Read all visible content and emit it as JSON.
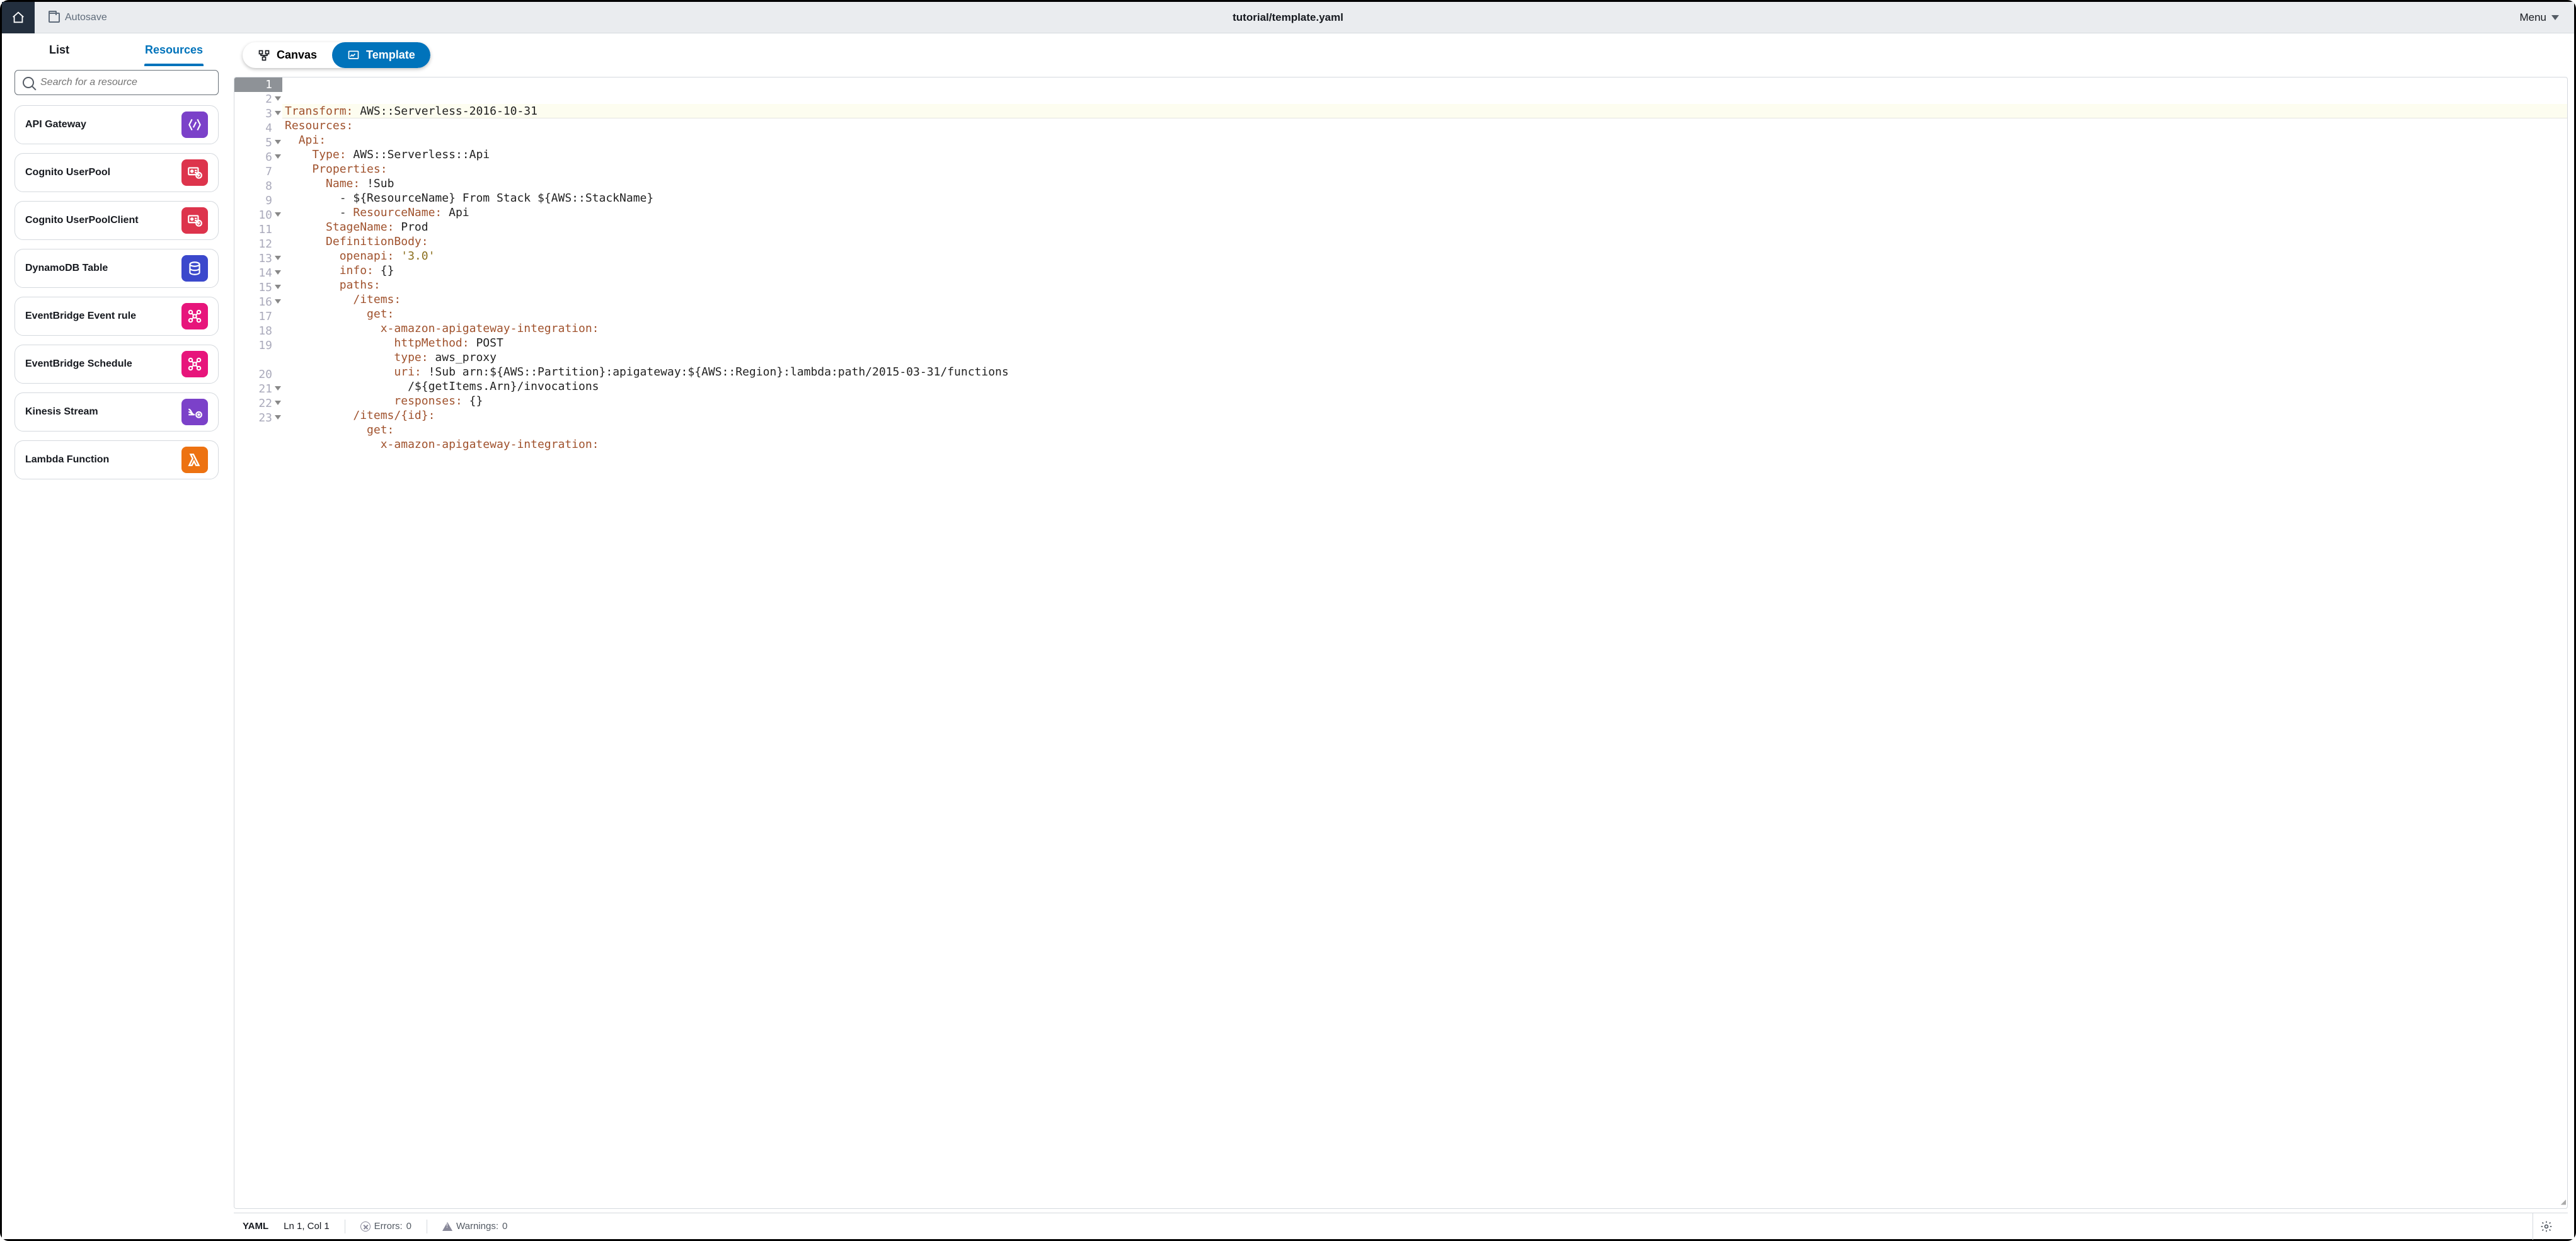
{
  "header": {
    "autosave_label": "Autosave",
    "title": "tutorial/template.yaml",
    "menu_label": "Menu"
  },
  "sidebar": {
    "tabs": {
      "list": "List",
      "resources": "Resources"
    },
    "search_placeholder": "Search for a resource",
    "items": [
      {
        "name": "API Gateway",
        "color": "#7b41c9"
      },
      {
        "name": "Cognito UserPool",
        "color": "#dd344c"
      },
      {
        "name": "Cognito UserPoolClient",
        "color": "#dd344c"
      },
      {
        "name": "DynamoDB Table",
        "color": "#3b48cc"
      },
      {
        "name": "EventBridge Event rule",
        "color": "#e7157b"
      },
      {
        "name": "EventBridge Schedule",
        "color": "#e7157b"
      },
      {
        "name": "Kinesis Stream",
        "color": "#7b41c9"
      },
      {
        "name": "Lambda Function",
        "color": "#ed7211"
      }
    ]
  },
  "view_switch": {
    "canvas": "Canvas",
    "template": "Template"
  },
  "editor": {
    "lines": [
      {
        "n": 1,
        "fold": false,
        "html": "<span class='k'>Transform:</span> <span class='v'>AWS::Serverless-2016-10-31</span>"
      },
      {
        "n": 2,
        "fold": true,
        "html": "<span class='k'>Resources:</span>"
      },
      {
        "n": 3,
        "fold": true,
        "html": "  <span class='k'>Api:</span>"
      },
      {
        "n": 4,
        "fold": false,
        "html": "    <span class='k'>Type:</span> <span class='v'>AWS::Serverless::Api</span>"
      },
      {
        "n": 5,
        "fold": true,
        "html": "    <span class='k'>Properties:</span>"
      },
      {
        "n": 6,
        "fold": true,
        "html": "      <span class='k'>Name:</span> <span class='v'>!Sub</span>"
      },
      {
        "n": 7,
        "fold": false,
        "html": "        - <span class='v'>${ResourceName} From Stack ${AWS::StackName}</span>"
      },
      {
        "n": 8,
        "fold": false,
        "html": "        - <span class='k'>ResourceName:</span> <span class='v'>Api</span>"
      },
      {
        "n": 9,
        "fold": false,
        "html": "      <span class='k'>StageName:</span> <span class='v'>Prod</span>"
      },
      {
        "n": 10,
        "fold": true,
        "html": "      <span class='k'>DefinitionBody:</span>"
      },
      {
        "n": 11,
        "fold": false,
        "html": "        <span class='k'>openapi:</span> <span class='s'>'3.0'</span>"
      },
      {
        "n": 12,
        "fold": false,
        "html": "        <span class='k'>info:</span> <span class='v'>{}</span>"
      },
      {
        "n": 13,
        "fold": true,
        "html": "        <span class='k'>paths:</span>"
      },
      {
        "n": 14,
        "fold": true,
        "html": "          <span class='k'>/items:</span>"
      },
      {
        "n": 15,
        "fold": true,
        "html": "            <span class='k'>get:</span>"
      },
      {
        "n": 16,
        "fold": true,
        "html": "              <span class='k'>x-amazon-apigateway-integration:</span>"
      },
      {
        "n": 17,
        "fold": false,
        "html": "                <span class='k'>httpMethod:</span> <span class='v'>POST</span>"
      },
      {
        "n": 18,
        "fold": false,
        "html": "                <span class='k'>type:</span> <span class='v'>aws_proxy</span>"
      },
      {
        "n": 19,
        "fold": false,
        "html": "                <span class='k'>uri:</span> <span class='v'>!Sub arn:${AWS::Partition}:apigateway:${AWS::Region}:lambda:path/2015-03-31/functions</span>"
      },
      {
        "n": 0,
        "fold": false,
        "html": "                  <span class='v'>/${getItems.Arn}/invocations</span>",
        "nolabel": true
      },
      {
        "n": 20,
        "fold": false,
        "html": "                <span class='k'>responses:</span> <span class='v'>{}</span>"
      },
      {
        "n": 21,
        "fold": true,
        "html": "          <span class='k'>/items/{id}:</span>"
      },
      {
        "n": 22,
        "fold": true,
        "html": "            <span class='k'>get:</span>"
      },
      {
        "n": 23,
        "fold": true,
        "html": "              <span class='k'>x-amazon-apigateway-integration:</span>"
      }
    ]
  },
  "status": {
    "lang": "YAML",
    "position": "Ln 1, Col 1",
    "errors_label": "Errors:",
    "errors_count": "0",
    "warnings_label": "Warnings:",
    "warnings_count": "0"
  }
}
